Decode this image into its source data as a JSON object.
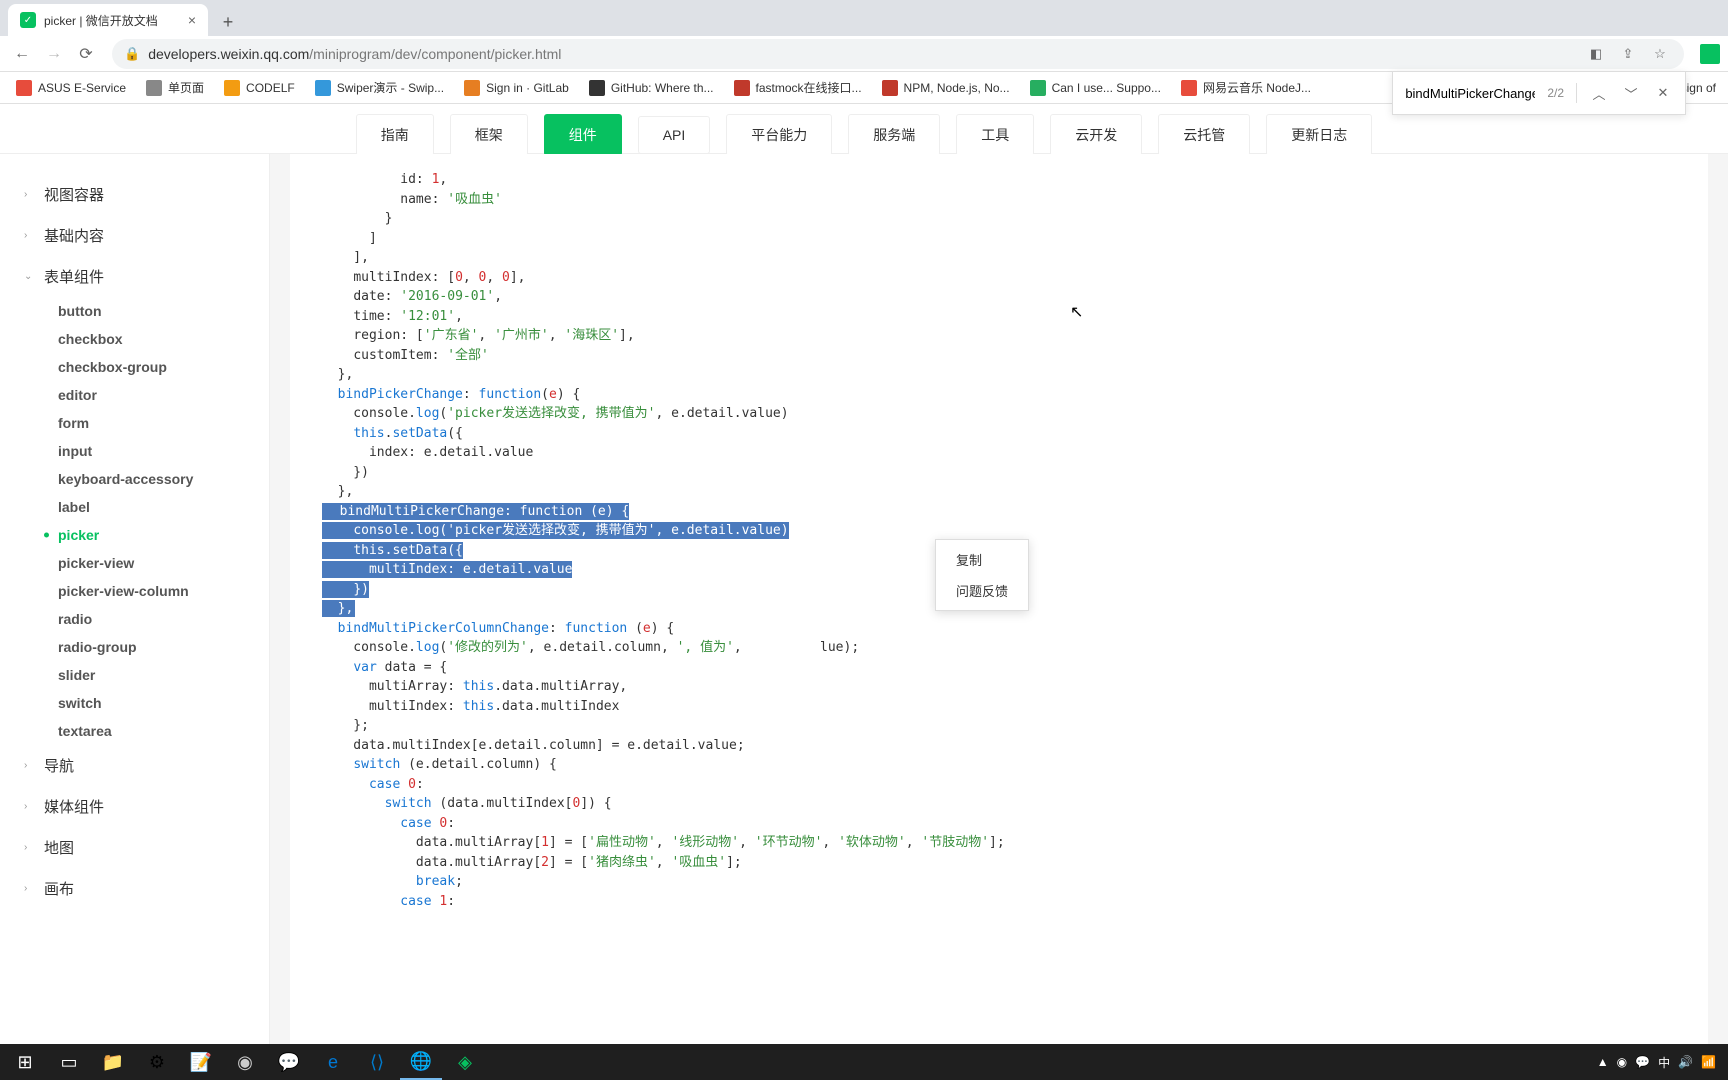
{
  "tab": {
    "title": "picker | 微信开放文档"
  },
  "url": {
    "domain": "developers.weixin.qq.com",
    "path": "/miniprogram/dev/component/picker.html"
  },
  "bookmarks": [
    {
      "label": "ASUS E-Service",
      "color": "#e74c3c"
    },
    {
      "label": "单页面",
      "color": "#888"
    },
    {
      "label": "CODELF",
      "color": "#f39c12"
    },
    {
      "label": "Swiper演示 - Swip...",
      "color": "#3498db"
    },
    {
      "label": "Sign in · GitLab",
      "color": "#e67e22"
    },
    {
      "label": "GitHub: Where th...",
      "color": "#333"
    },
    {
      "label": "fastmock在线接口...",
      "color": "#c0392b"
    },
    {
      "label": "NPM, Node.js, No...",
      "color": "#c0392b"
    },
    {
      "label": "Can I use... Suppo...",
      "color": "#27ae60"
    },
    {
      "label": "网易云音乐 NodeJ...",
      "color": "#e74c3c"
    },
    {
      "label": "lesign of",
      "color": "#888"
    }
  ],
  "find": {
    "query": "bindMultiPickerChange",
    "count": "2/2"
  },
  "topTabs": [
    "指南",
    "框架",
    "组件",
    "API",
    "平台能力",
    "服务端",
    "工具",
    "云开发",
    "云托管",
    "更新日志"
  ],
  "topActive": 2,
  "sidebar": {
    "groups": [
      "视图容器",
      "基础内容",
      "表单组件",
      "导航",
      "媒体组件",
      "地图",
      "画布"
    ],
    "formItems": [
      "button",
      "checkbox",
      "checkbox-group",
      "editor",
      "form",
      "input",
      "keyboard-accessory",
      "label",
      "picker",
      "picker-view",
      "picker-view-column",
      "radio",
      "radio-group",
      "slider",
      "switch",
      "textarea"
    ],
    "activeSub": "picker"
  },
  "code": {
    "id": "id: ",
    "idv": "1",
    "name": "name: ",
    "namev": "'吸血虫'",
    "multiIndex": "multiIndex: [",
    "mi0": "0",
    "mi1": "0",
    "mi2": "0",
    "date": "date: ",
    "datev": "'2016-09-01'",
    "time": "time: ",
    "timev": "'12:01'",
    "region": "region: [",
    "r0": "'广东省'",
    "r1": "'广州市'",
    "r2": "'海珠区'",
    "customItem": "customItem: ",
    "civ": "'全部'",
    "bpc": "bindPickerChange",
    "fn": "function",
    "e": "e",
    "log": "log",
    "logstr": "'picker发送选择改变, 携带值为'",
    "this": "this",
    "setData": "setData",
    "bmpc": "bindMultiPickerChange: function (e) {",
    "bmpcl1": "console.log('picker发送选择改变, 携带值为', e.detail.value)",
    "bmpcl2": "this.setData({",
    "bmpcl3": "multiIndex: e.detail.value",
    "bmpcl4": "})",
    "bmpcl5": "},",
    "bmpcc": "bindMultiPickerColumnChange",
    "colstr": "'修改的列为'",
    "valstr": "', 值为'",
    "var": "var",
    "switch": "switch",
    "case": "case",
    "break": "break",
    "c0": "0",
    "c1": "1",
    "c2": "2",
    "a1": "'扁性动物'",
    "a2": "'线形动物'",
    "a3": "'环节动物'",
    "a4": "'软体动物'",
    "a5": "'节肢动物'",
    "b1": "'猪肉绦虫'",
    "b2": "'吸血虫'"
  },
  "ctxMenu": [
    "复制",
    "问题反馈"
  ]
}
